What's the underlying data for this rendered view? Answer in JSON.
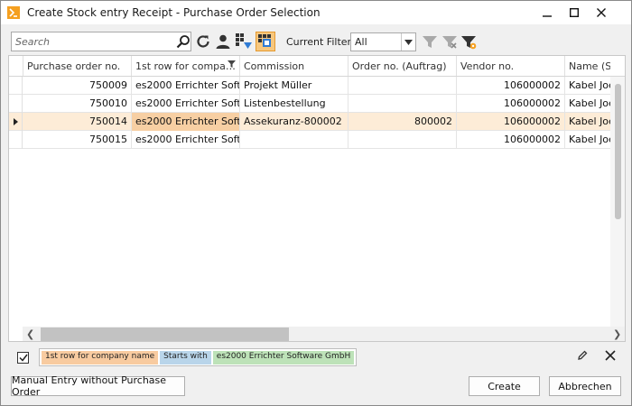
{
  "window": {
    "title": "Create Stock entry Receipt - Purchase Order Selection"
  },
  "toolbar": {
    "search_placeholder": "Search",
    "current_filter_label": "Current Filter:",
    "current_filter_value": "All"
  },
  "grid": {
    "columns": [
      "Purchase order no.",
      "1st row for compa…",
      "Commission",
      "Order no. (Auftrag)",
      "Vendor no.",
      "Name (Su"
    ],
    "rows": [
      {
        "po": "750009",
        "company": "es2000 Errichter Soft…",
        "commission": "Projekt Müller",
        "order": "",
        "vendor": "106000002",
        "name": "Kabel Joe",
        "selected": false
      },
      {
        "po": "750010",
        "company": "es2000 Errichter Soft…",
        "commission": "Listenbestellung",
        "order": "",
        "vendor": "106000002",
        "name": "Kabel Joe",
        "selected": false
      },
      {
        "po": "750014",
        "company": "es2000 Errichter Soft…",
        "commission": "Assekuranz-800002",
        "order": "800002",
        "vendor": "106000002",
        "name": "Kabel Joe",
        "selected": true
      },
      {
        "po": "750015",
        "company": "es2000 Errichter Soft…",
        "commission": "",
        "order": "",
        "vendor": "106000002",
        "name": "Kabel Joe",
        "selected": false
      }
    ]
  },
  "filter_bar": {
    "chip_field": "1st row for company name",
    "chip_operator": "Starts with",
    "chip_value": "es2000 Errichter Software GmbH"
  },
  "buttons": {
    "manual_entry": "Manual Entry without Purchase Order",
    "create": "Create",
    "cancel": "Abbrechen"
  },
  "colors": {
    "accent": "#f5a020",
    "selected_row": "#fdecd7",
    "highlight_cell": "#f7cfa3",
    "chip_field": "#f8cba0",
    "chip_operator": "#b9d5ea",
    "chip_value": "#bde2b8"
  },
  "icons": {
    "app": "app-icon",
    "search": "search-icon",
    "refresh": "refresh-icon",
    "user": "user-icon",
    "grid_filter": "grid-filter-icon",
    "grid_filter_active": "grid-filter-active-icon",
    "funnel": "funnel-icon",
    "funnel_clear": "funnel-clear-icon",
    "funnel_settings": "funnel-settings-icon",
    "edit": "pencil-icon",
    "remove": "close-icon"
  }
}
